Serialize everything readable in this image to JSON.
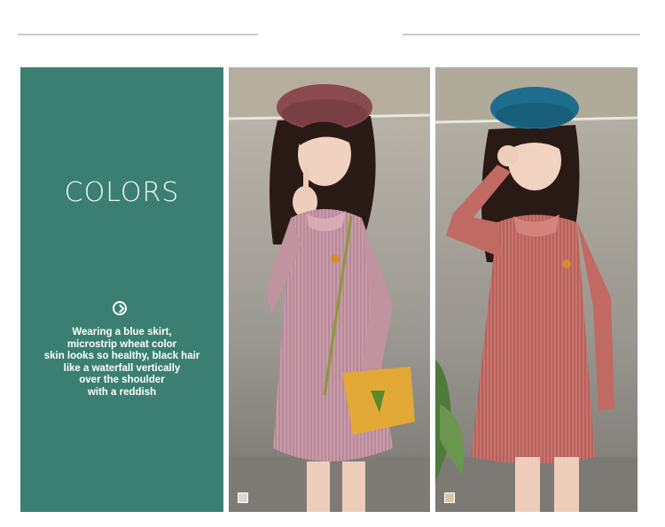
{
  "panel": {
    "title": "COLORS",
    "description": [
      "Wearing a blue skirt,",
      "microstrip wheat color",
      "skin looks so healthy, black hair",
      "like a waterfall vertically",
      "over the shoulder",
      "with a reddish"
    ],
    "arrow_icon": "circle-arrow-right-icon"
  },
  "photos": [
    {
      "name": "pink-dress-photo",
      "swatch_color": "#d8d8d8",
      "dress_color": "#c98f9c",
      "hat_color": "#8a4a4f"
    },
    {
      "name": "coral-dress-photo",
      "swatch_color": "#d9c79a",
      "dress_color": "#c8706a",
      "hat_color": "#1e6d8c"
    }
  ],
  "colors": {
    "panel_bg": "#3b7f72",
    "rule": "#c9c9c9"
  }
}
